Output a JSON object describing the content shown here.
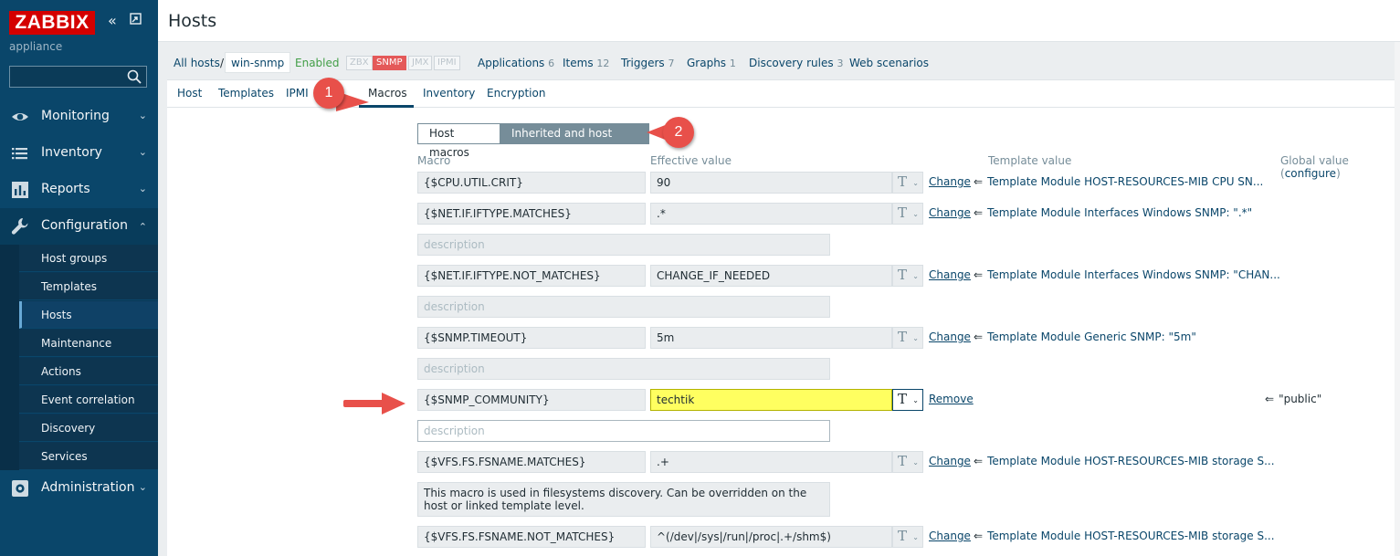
{
  "sidebar": {
    "logo": "ZABBIX",
    "subtitle": "appliance",
    "search_placeholder": "",
    "menu": [
      {
        "label": "Monitoring",
        "icon": "eye-icon"
      },
      {
        "label": "Inventory",
        "icon": "list-icon"
      },
      {
        "label": "Reports",
        "icon": "bar-chart-icon"
      },
      {
        "label": "Configuration",
        "icon": "wrench-icon"
      },
      {
        "label": "Administration",
        "icon": "gear-icon"
      }
    ],
    "config_items": [
      "Host groups",
      "Templates",
      "Hosts",
      "Maintenance",
      "Actions",
      "Event correlation",
      "Discovery",
      "Services"
    ],
    "active_item": "Hosts"
  },
  "header": {
    "title": "Hosts"
  },
  "nav": {
    "all_hosts": "All hosts",
    "separator": "/",
    "host": "win-snmp",
    "status": "Enabled",
    "protocols": [
      "ZBX",
      "SNMP",
      "JMX",
      "IPMI"
    ],
    "active_protocol": "SNMP",
    "links": [
      {
        "label": "Applications",
        "count": "6"
      },
      {
        "label": "Items",
        "count": "12"
      },
      {
        "label": "Triggers",
        "count": "7"
      },
      {
        "label": "Graphs",
        "count": "1"
      },
      {
        "label": "Discovery rules",
        "count": "3"
      },
      {
        "label": "Web scenarios",
        "count": ""
      }
    ]
  },
  "tabs": [
    "Host",
    "Templates",
    "IPMI",
    "Macros",
    "Inventory",
    "Encryption"
  ],
  "active_tab": "Macros",
  "macro_toggle": {
    "left": "Host macros",
    "right": "Inherited and host macros",
    "active": "right"
  },
  "columns": {
    "macro": "Macro",
    "effective": "Effective value",
    "template": "Template value",
    "global": "Global value (",
    "configure": "configure",
    "global_end": ")"
  },
  "description_placeholder": "description",
  "macros": [
    {
      "name": "{$CPU.UTIL.CRIT}",
      "value": "90",
      "action": "Change",
      "template": "Template Module HOST-RESOURCES-MIB CPU SN...",
      "desc": null
    },
    {
      "name": "{$NET.IF.IFTYPE.MATCHES}",
      "value": ".*",
      "action": "Change",
      "template": "Template Module Interfaces Windows SNMP: \".*\"",
      "desc": ""
    },
    {
      "name": "{$NET.IF.IFTYPE.NOT_MATCHES}",
      "value": "CHANGE_IF_NEEDED",
      "action": "Change",
      "template": "Template Module Interfaces Windows SNMP: \"CHAN...",
      "desc": ""
    },
    {
      "name": "{$SNMP.TIMEOUT}",
      "value": "5m",
      "action": "Change",
      "template": "Template Module Generic SNMP: \"5m\"",
      "desc": ""
    },
    {
      "name": "{$SNMP_COMMUNITY}",
      "value": "techtik",
      "action": "Remove",
      "template": "",
      "global": "\"public\"",
      "desc": ""
    },
    {
      "name": "{$VFS.FS.FSNAME.MATCHES}",
      "value": ".+",
      "action": "Change",
      "template": "Template Module HOST-RESOURCES-MIB storage S...",
      "desc": "This macro is used in filesystems discovery. Can be overridden on the host or linked template level."
    },
    {
      "name": "{$VFS.FS.FSNAME.NOT_MATCHES}",
      "value": "^(/dev|/sys|/run|/proc|.+/shm$)",
      "action": "Change",
      "template": "Template Module HOST-RESOURCES-MIB storage S...",
      "desc": null
    }
  ],
  "type_glyph": "T",
  "inherit_arrow": "⇐",
  "callouts": [
    "1",
    "2"
  ],
  "colors": {
    "sidebar": "#0a466a",
    "logo": "#d40000",
    "highlight": "#ffff60",
    "callout": "#e8504a",
    "enabled": "#429e47"
  }
}
